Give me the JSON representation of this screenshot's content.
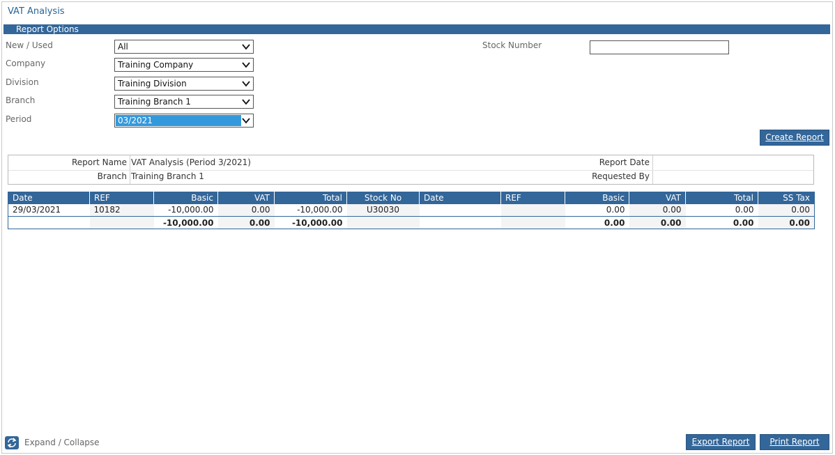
{
  "title": "VAT Analysis",
  "section": "Report Options",
  "filters": {
    "new_used": {
      "label": "New / Used",
      "value": "All"
    },
    "company": {
      "label": "Company",
      "value": "Training Company"
    },
    "division": {
      "label": "Division",
      "value": "Training Division"
    },
    "branch": {
      "label": "Branch",
      "value": "Training Branch 1"
    },
    "period": {
      "label": "Period",
      "value": "03/2021"
    },
    "stock_number": {
      "label": "Stock Number",
      "value": ""
    }
  },
  "buttons": {
    "create": "Create Report",
    "export": "Export Report",
    "print": "Print Report"
  },
  "info": {
    "report_name_label": "Report Name",
    "report_name": "VAT Analysis (Period 3/2021)",
    "branch_label": "Branch",
    "branch": "Training Branch 1",
    "report_date_label": "Report Date",
    "report_date": "",
    "requested_by_label": "Requested By",
    "requested_by": ""
  },
  "table": {
    "headers": [
      "Date",
      "REF",
      "Basic",
      "VAT",
      "Total",
      "Stock No",
      "Date",
      "REF",
      "Basic",
      "VAT",
      "Total",
      "SS Tax"
    ],
    "rows": [
      [
        "29/03/2021",
        "10182",
        "-10,000.00",
        "0.00",
        "-10,000.00",
        "U30030",
        "",
        "",
        "0.00",
        "0.00",
        "0.00",
        "0.00"
      ]
    ],
    "totals": [
      "",
      "",
      "-10,000.00",
      "0.00",
      "-10,000.00",
      "",
      "",
      "",
      "0.00",
      "0.00",
      "0.00",
      "0.00"
    ]
  },
  "footer": {
    "expand_collapse": "Expand / Collapse",
    "icon": "refresh-icon"
  },
  "colors": {
    "accent": "#336699",
    "selection": "#3399dd"
  }
}
